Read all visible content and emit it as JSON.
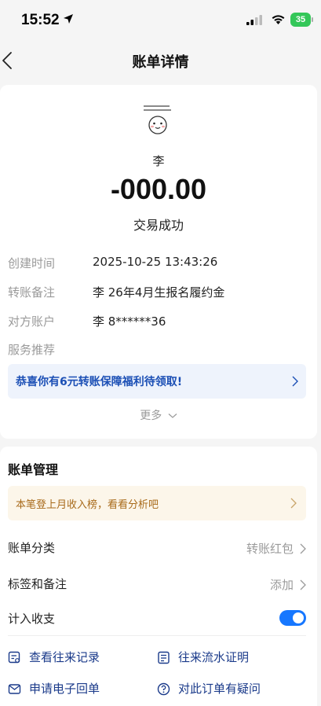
{
  "status_bar": {
    "time": "15:52",
    "battery": "35"
  },
  "nav": {
    "title": "账单详情"
  },
  "transaction": {
    "name": "李",
    "amount": "-000.00",
    "status": "交易成功",
    "details": [
      {
        "label": "创建时间",
        "value": "2025-10-25 13:43:26"
      },
      {
        "label": "转账备注",
        "value": "李  26年4月生报名履约金"
      },
      {
        "label": "对方账户",
        "value": "李  8******36"
      },
      {
        "label": "服务推荐",
        "value": ""
      }
    ],
    "promo_text": "恭喜你有6元转账保障福利待领取!",
    "more_label": "更多"
  },
  "management": {
    "title": "账单管理",
    "tip_text": "本笔登上月收入榜，看看分析吧",
    "rows": [
      {
        "label": "账单分类",
        "value": "转账红包"
      },
      {
        "label": "标签和备注",
        "value": "添加"
      },
      {
        "label": "计入收支",
        "value": ""
      }
    ],
    "include_in_stats": true,
    "actions": [
      {
        "label": "查看往来记录",
        "icon": "records-icon"
      },
      {
        "label": "往来流水证明",
        "icon": "statement-icon"
      },
      {
        "label": "申请电子回单",
        "icon": "mail-icon"
      },
      {
        "label": "对此订单有疑问",
        "icon": "question-icon"
      }
    ]
  },
  "colors": {
    "accent": "#1677ff",
    "promo_text": "#1b4fb5",
    "tip_text": "#a86a1a",
    "battery": "#34c759"
  }
}
